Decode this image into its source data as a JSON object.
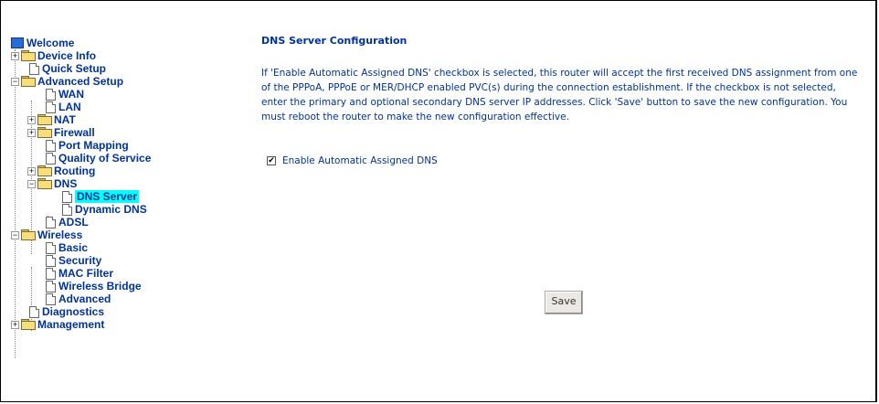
{
  "tree": {
    "root": "Welcome",
    "device_info": "Device Info",
    "quick_setup": "Quick Setup",
    "advanced_setup": "Advanced Setup",
    "wan": "WAN",
    "lan": "LAN",
    "nat": "NAT",
    "firewall": "Firewall",
    "port_mapping": "Port Mapping",
    "qos": "Quality of Service",
    "routing": "Routing",
    "dns": "DNS",
    "dns_server": "DNS Server",
    "dynamic_dns": "Dynamic DNS",
    "adsl": "ADSL",
    "wireless": "Wireless",
    "basic": "Basic",
    "security": "Security",
    "mac_filter": "MAC Filter",
    "wireless_bridge": "Wireless Bridge",
    "advanced": "Advanced",
    "diagnostics": "Diagnostics",
    "management": "Management",
    "selected": "DNS Server",
    "highlight_color": "#00ffff"
  },
  "main": {
    "title": "DNS Server Configuration",
    "description": "If 'Enable Automatic Assigned DNS' checkbox is selected, this router will accept the first received DNS assignment from one of the PPPoA, PPPoE or MER/DHCP enabled PVC(s) during the connection establishment. If the checkbox is not selected, enter the primary and optional secondary DNS server IP addresses. Click 'Save' button to save the new configuration. You must reboot the router to make the new configuration effective.",
    "checkbox_label": "Enable Automatic Assigned DNS",
    "checkbox_checked": true,
    "save_label": "Save",
    "text_color": "#00339a"
  }
}
